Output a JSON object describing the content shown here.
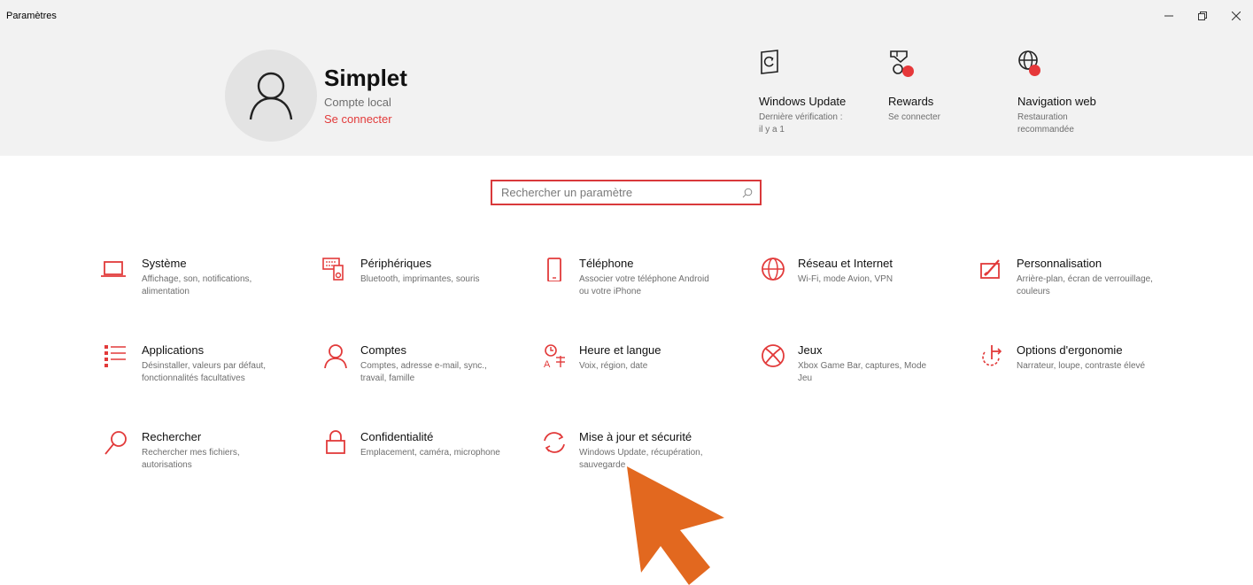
{
  "window": {
    "title": "Paramètres",
    "minimize_label": "Réduire",
    "maximize_label": "Agrandir",
    "close_label": "Fermer"
  },
  "profile": {
    "name": "Simplet",
    "account_type": "Compte local",
    "signin_link": "Se connecter"
  },
  "quick_tiles": [
    {
      "title": "Windows Update",
      "subtitle": "Dernière vérification : il y a 1",
      "icon": "windows-update-icon"
    },
    {
      "title": "Rewards",
      "subtitle": "Se connecter",
      "icon": "rewards-icon"
    },
    {
      "title": "Navigation web",
      "subtitle": "Restauration recommandée",
      "icon": "web-browsing-icon"
    }
  ],
  "search": {
    "placeholder": "Rechercher un paramètre",
    "value": ""
  },
  "categories": [
    {
      "title": "Système",
      "subtitle": "Affichage, son, notifications, alimentation",
      "icon": "laptop-icon"
    },
    {
      "title": "Périphériques",
      "subtitle": "Bluetooth, imprimantes, souris",
      "icon": "keyboard-speaker-icon"
    },
    {
      "title": "Téléphone",
      "subtitle": "Associer votre téléphone Android ou votre iPhone",
      "icon": "phone-icon"
    },
    {
      "title": "Réseau et Internet",
      "subtitle": "Wi-Fi, mode Avion, VPN",
      "icon": "globe-icon"
    },
    {
      "title": "Personnalisation",
      "subtitle": "Arrière-plan, écran de verrouillage, couleurs",
      "icon": "paint-screen-icon"
    },
    {
      "title": "Applications",
      "subtitle": "Désinstaller, valeurs par défaut, fonctionnalités facultatives",
      "icon": "apps-list-icon"
    },
    {
      "title": "Comptes",
      "subtitle": "Comptes, adresse e-mail, sync., travail, famille",
      "icon": "person-icon"
    },
    {
      "title": "Heure et langue",
      "subtitle": "Voix, région, date",
      "icon": "time-language-icon"
    },
    {
      "title": "Jeux",
      "subtitle": "Xbox Game Bar, captures, Mode Jeu",
      "icon": "xbox-icon"
    },
    {
      "title": "Options d'ergonomie",
      "subtitle": "Narrateur, loupe, contraste élevé",
      "icon": "ease-of-access-icon"
    },
    {
      "title": "Rechercher",
      "subtitle": "Rechercher mes fichiers, autorisations",
      "icon": "search-magnifier-icon"
    },
    {
      "title": "Confidentialité",
      "subtitle": "Emplacement, caméra, microphone",
      "icon": "lock-icon"
    },
    {
      "title": "Mise à jour et sécurité",
      "subtitle": "Windows Update, récupération, sauvegarde",
      "icon": "sync-arrows-icon"
    }
  ],
  "colors": {
    "accent": "#e23a3a",
    "header_bg": "#f2f2f2",
    "pointer": "#e2681f"
  }
}
